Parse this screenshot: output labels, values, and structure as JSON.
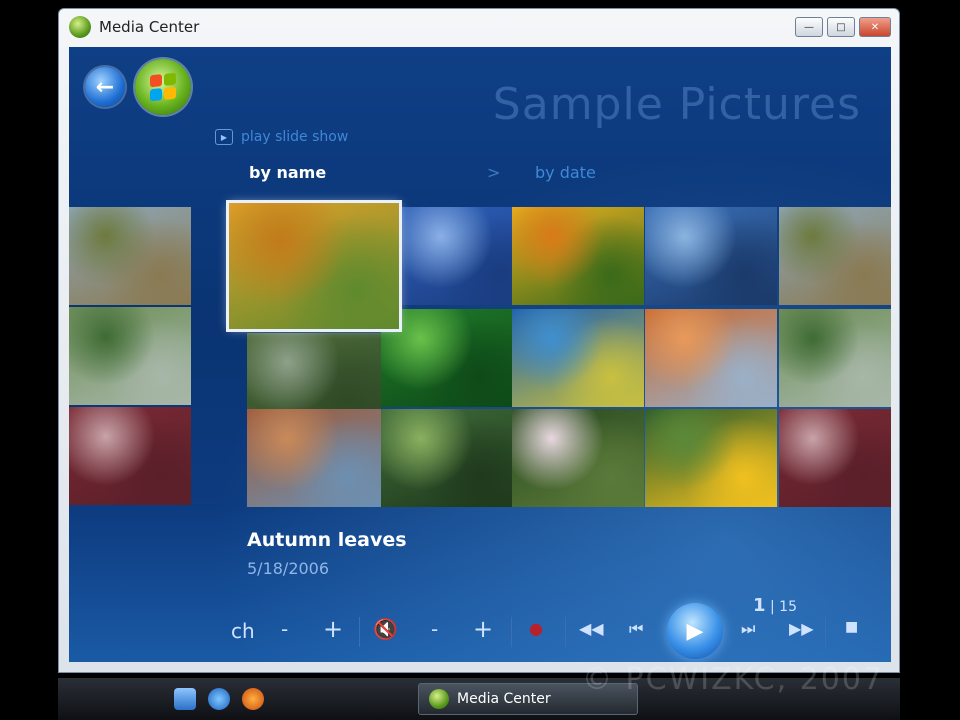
{
  "window": {
    "title": "Media Center",
    "controls": [
      "minimize",
      "maximize",
      "close"
    ]
  },
  "page": {
    "title": "Sample Pictures",
    "slideshow_label": "play slide show",
    "sort_by_name": "by name",
    "sort_separator": ">",
    "sort_by_date": "by date"
  },
  "thumbnails": [
    {
      "name": "trees-left",
      "colors": [
        "#8ea7b8",
        "#6d7a3e",
        "#8a7a52"
      ]
    },
    {
      "name": "waterfall-left",
      "colors": [
        "#6f8f5a",
        "#3f6b34",
        "#a7b7a8"
      ]
    },
    {
      "name": "flower-left",
      "colors": [
        "#7a2a34",
        "#c7a3a8",
        "#5a1f2a"
      ]
    },
    {
      "name": "autumn-leaves",
      "colors": [
        "#e0a22a",
        "#c27a1a",
        "#5f8a2e"
      ]
    },
    {
      "name": "waterfall-mid",
      "colors": [
        "#4d6b3a",
        "#8ea08a",
        "#2f4a26"
      ]
    },
    {
      "name": "desert-rocks",
      "colors": [
        "#9c5a3a",
        "#c98a5a",
        "#6d8fb0"
      ]
    },
    {
      "name": "blue-hills",
      "colors": [
        "#2d5fb8",
        "#8ab0e6",
        "#1a3c80"
      ]
    },
    {
      "name": "green-leaves",
      "colors": [
        "#1f7a2a",
        "#6ac24a",
        "#0e4a18"
      ]
    },
    {
      "name": "forest-path",
      "colors": [
        "#3f6b3a",
        "#8ab060",
        "#1f3a1c"
      ]
    },
    {
      "name": "yellow-flowers",
      "colors": [
        "#e8b020",
        "#d87a18",
        "#3a6a1a"
      ]
    },
    {
      "name": "sea-turtle",
      "colors": [
        "#1f5fa8",
        "#3f8fd0",
        "#c8c040"
      ]
    },
    {
      "name": "white-flowers",
      "colors": [
        "#2a4a20",
        "#e8d8e0",
        "#5a7a3a"
      ]
    },
    {
      "name": "whale-tail",
      "colors": [
        "#3a6fb8",
        "#8ab4e0",
        "#1a3a6a"
      ]
    },
    {
      "name": "desert-dunes",
      "colors": [
        "#c86a30",
        "#e89a5a",
        "#9ab0c8"
      ]
    },
    {
      "name": "toucan",
      "colors": [
        "#2a5a2a",
        "#5a8a3a",
        "#f0c020"
      ]
    },
    {
      "name": "trees-right",
      "colors": [
        "#8ea7b8",
        "#6d7a3e",
        "#8a7a52"
      ]
    },
    {
      "name": "waterfall-right",
      "colors": [
        "#6f8f5a",
        "#3f6b34",
        "#a7b7a8"
      ]
    },
    {
      "name": "flower-right",
      "colors": [
        "#7a2a34",
        "#c7a3a8",
        "#5a1f2a"
      ]
    }
  ],
  "selected_item": {
    "title": "Autumn leaves",
    "date": "5/18/2006"
  },
  "transport": {
    "ch_label": "ch",
    "minus": "-",
    "plus": "+",
    "counter_current": "1",
    "counter_sep": "|",
    "counter_total": "15"
  },
  "taskbar": {
    "task_label": "Media Center"
  },
  "watermark": "© PCWIZKC, 2007"
}
